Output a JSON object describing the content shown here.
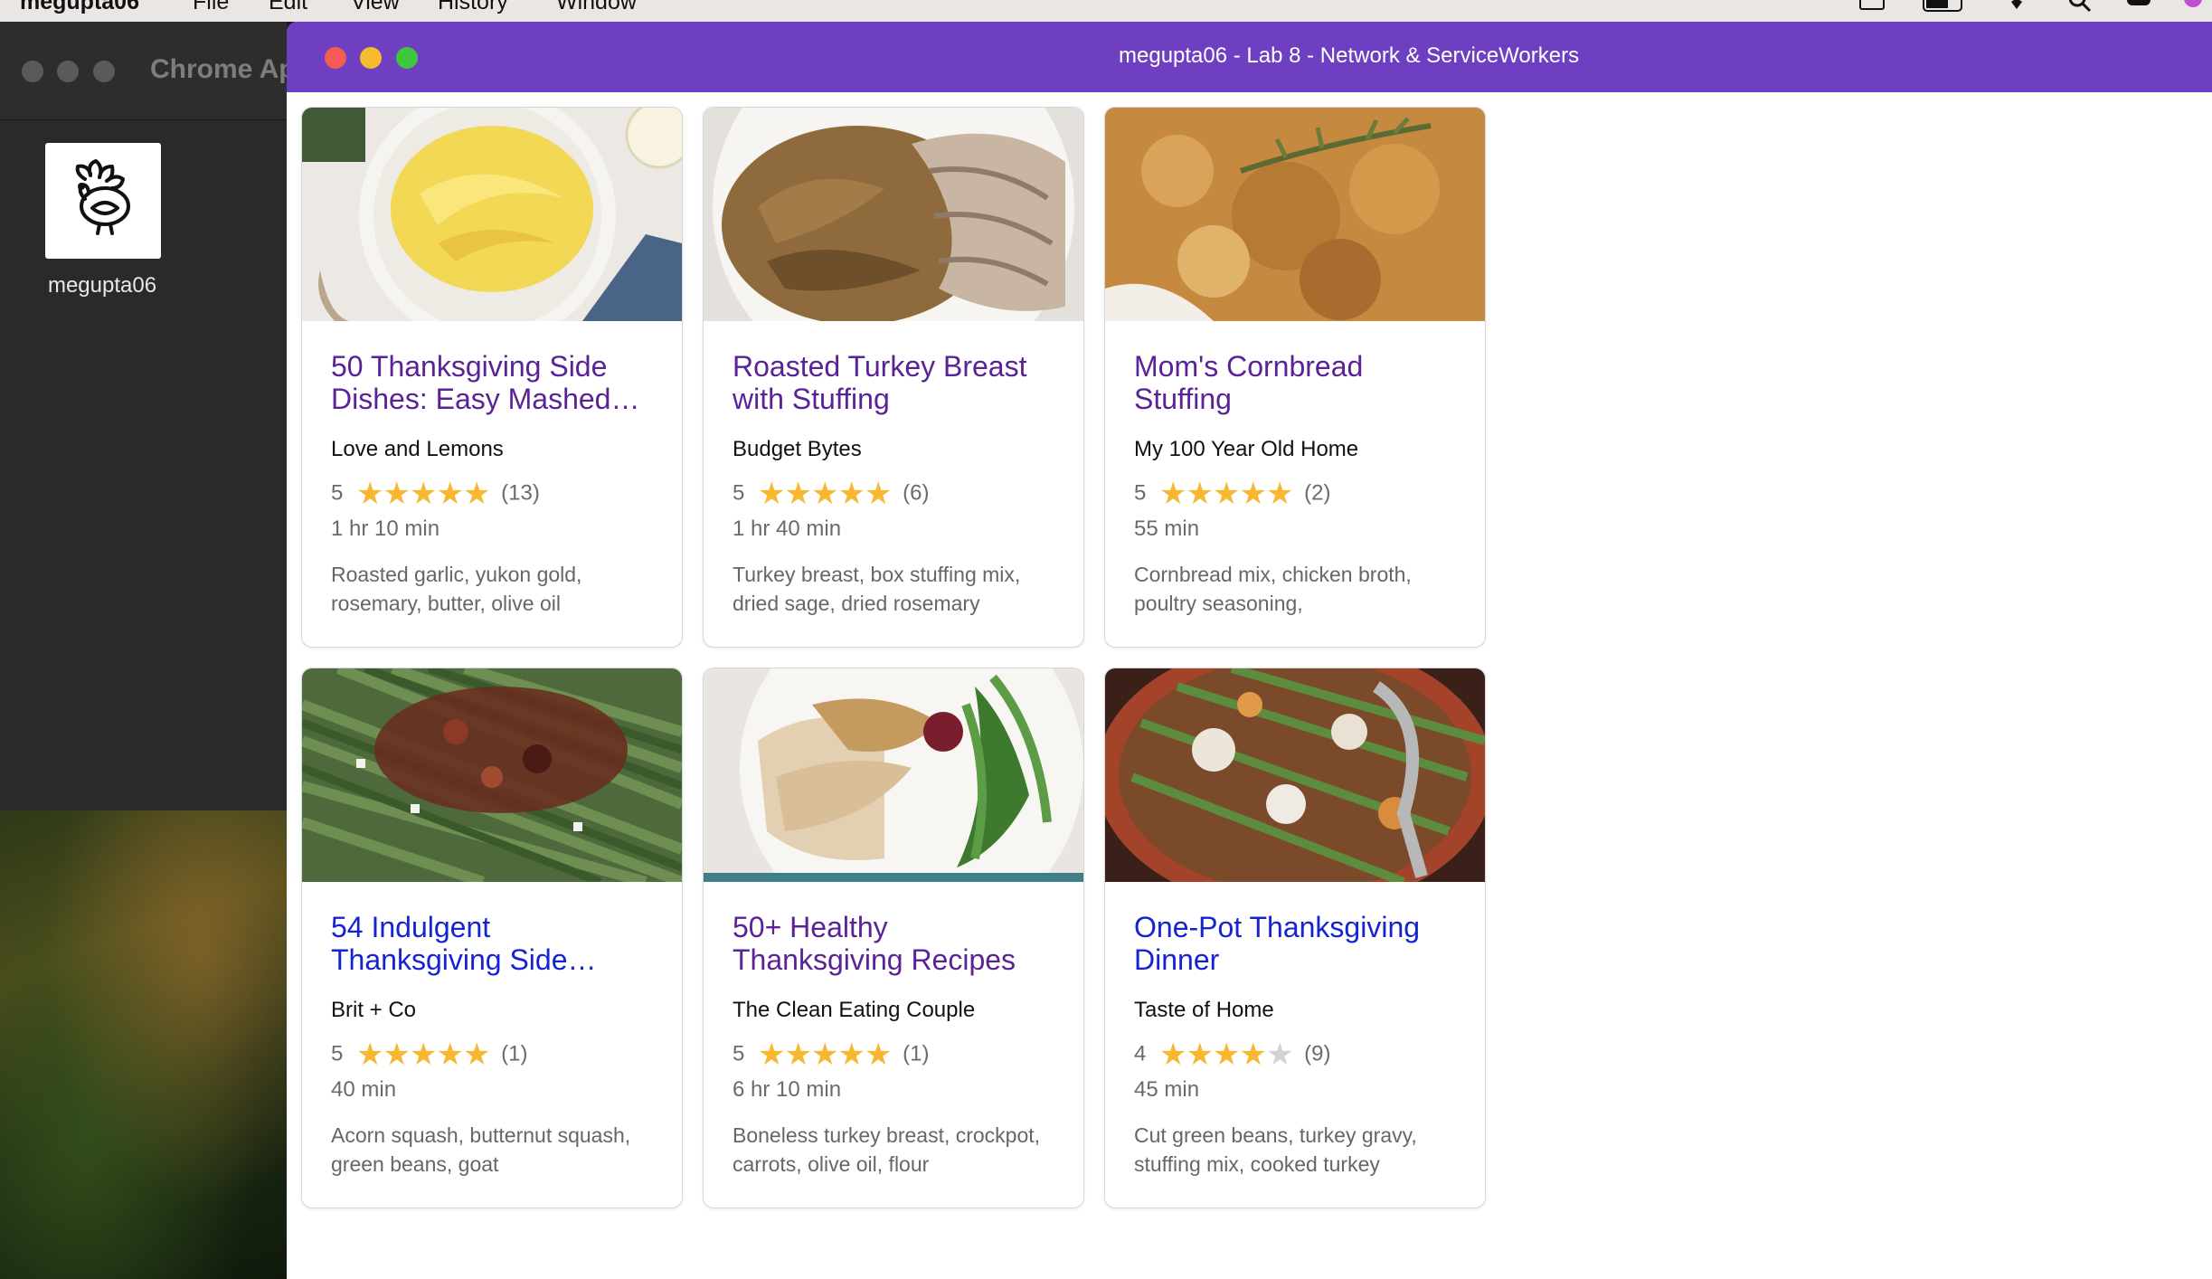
{
  "menu_bar": {
    "app_name": "megupta06",
    "items": [
      "File",
      "Edit",
      "View",
      "History",
      "Window"
    ]
  },
  "background_window": {
    "title": "Chrome Ap",
    "app_label": "megupta06"
  },
  "window": {
    "title": "megupta06 - Lab 8 - Network & ServiceWorkers",
    "titlebar_color": "#6f3fc1"
  },
  "colors": {
    "visited_link": "#5b2295",
    "unvisited_link": "#1523d1",
    "star": "#f7b731",
    "star_empty": "#d2d2d2"
  },
  "recipes": [
    {
      "title": "50 Thanksgiving Side Dishes: Easy Mashed…",
      "source": "Love and Lemons",
      "rating": "5",
      "stars_filled": 5,
      "reviews": "(13)",
      "time": "1 hr 10 min",
      "ingredients": "Roasted garlic, yukon gold, rosemary, butter, olive oil",
      "visited": true,
      "image": "mashed-potatoes-image"
    },
    {
      "title": "Roasted Turkey Breast with Stuffing",
      "source": "Budget Bytes",
      "rating": "5",
      "stars_filled": 5,
      "reviews": "(6)",
      "time": "1 hr 40 min",
      "ingredients": "Turkey breast, box stuffing mix, dried sage, dried rosemary",
      "visited": true,
      "image": "turkey-stuffing-image"
    },
    {
      "title": "Mom's Cornbread Stuffing",
      "source": "My 100 Year Old Home",
      "rating": "5",
      "stars_filled": 5,
      "reviews": "(2)",
      "time": "55 min",
      "ingredients": "Cornbread mix, chicken broth, poultry seasoning,",
      "visited": true,
      "image": "cornbread-stuffing-image"
    },
    {
      "title": "54 Indulgent Thanksgiving Side…",
      "source": "Brit + Co",
      "rating": "5",
      "stars_filled": 5,
      "reviews": "(1)",
      "time": "40 min",
      "ingredients": "Acorn squash, butternut squash, green beans, goat",
      "visited": false,
      "image": "green-beans-image"
    },
    {
      "title": "50+ Healthy Thanksgiving Recipes",
      "source": "The Clean Eating Couple",
      "rating": "5",
      "stars_filled": 5,
      "reviews": "(1)",
      "time": "6 hr 10 min",
      "ingredients": "Boneless turkey breast, crockpot, carrots, olive oil, flour",
      "visited": true,
      "image": "sliced-turkey-plate-image"
    },
    {
      "title": "One-Pot Thanksgiving Dinner",
      "source": "Taste of Home",
      "rating": "4",
      "stars_filled": 4,
      "reviews": "(9)",
      "time": "45 min",
      "ingredients": "Cut green beans, turkey gravy, stuffing mix, cooked turkey",
      "visited": false,
      "image": "one-pot-dinner-image"
    }
  ]
}
